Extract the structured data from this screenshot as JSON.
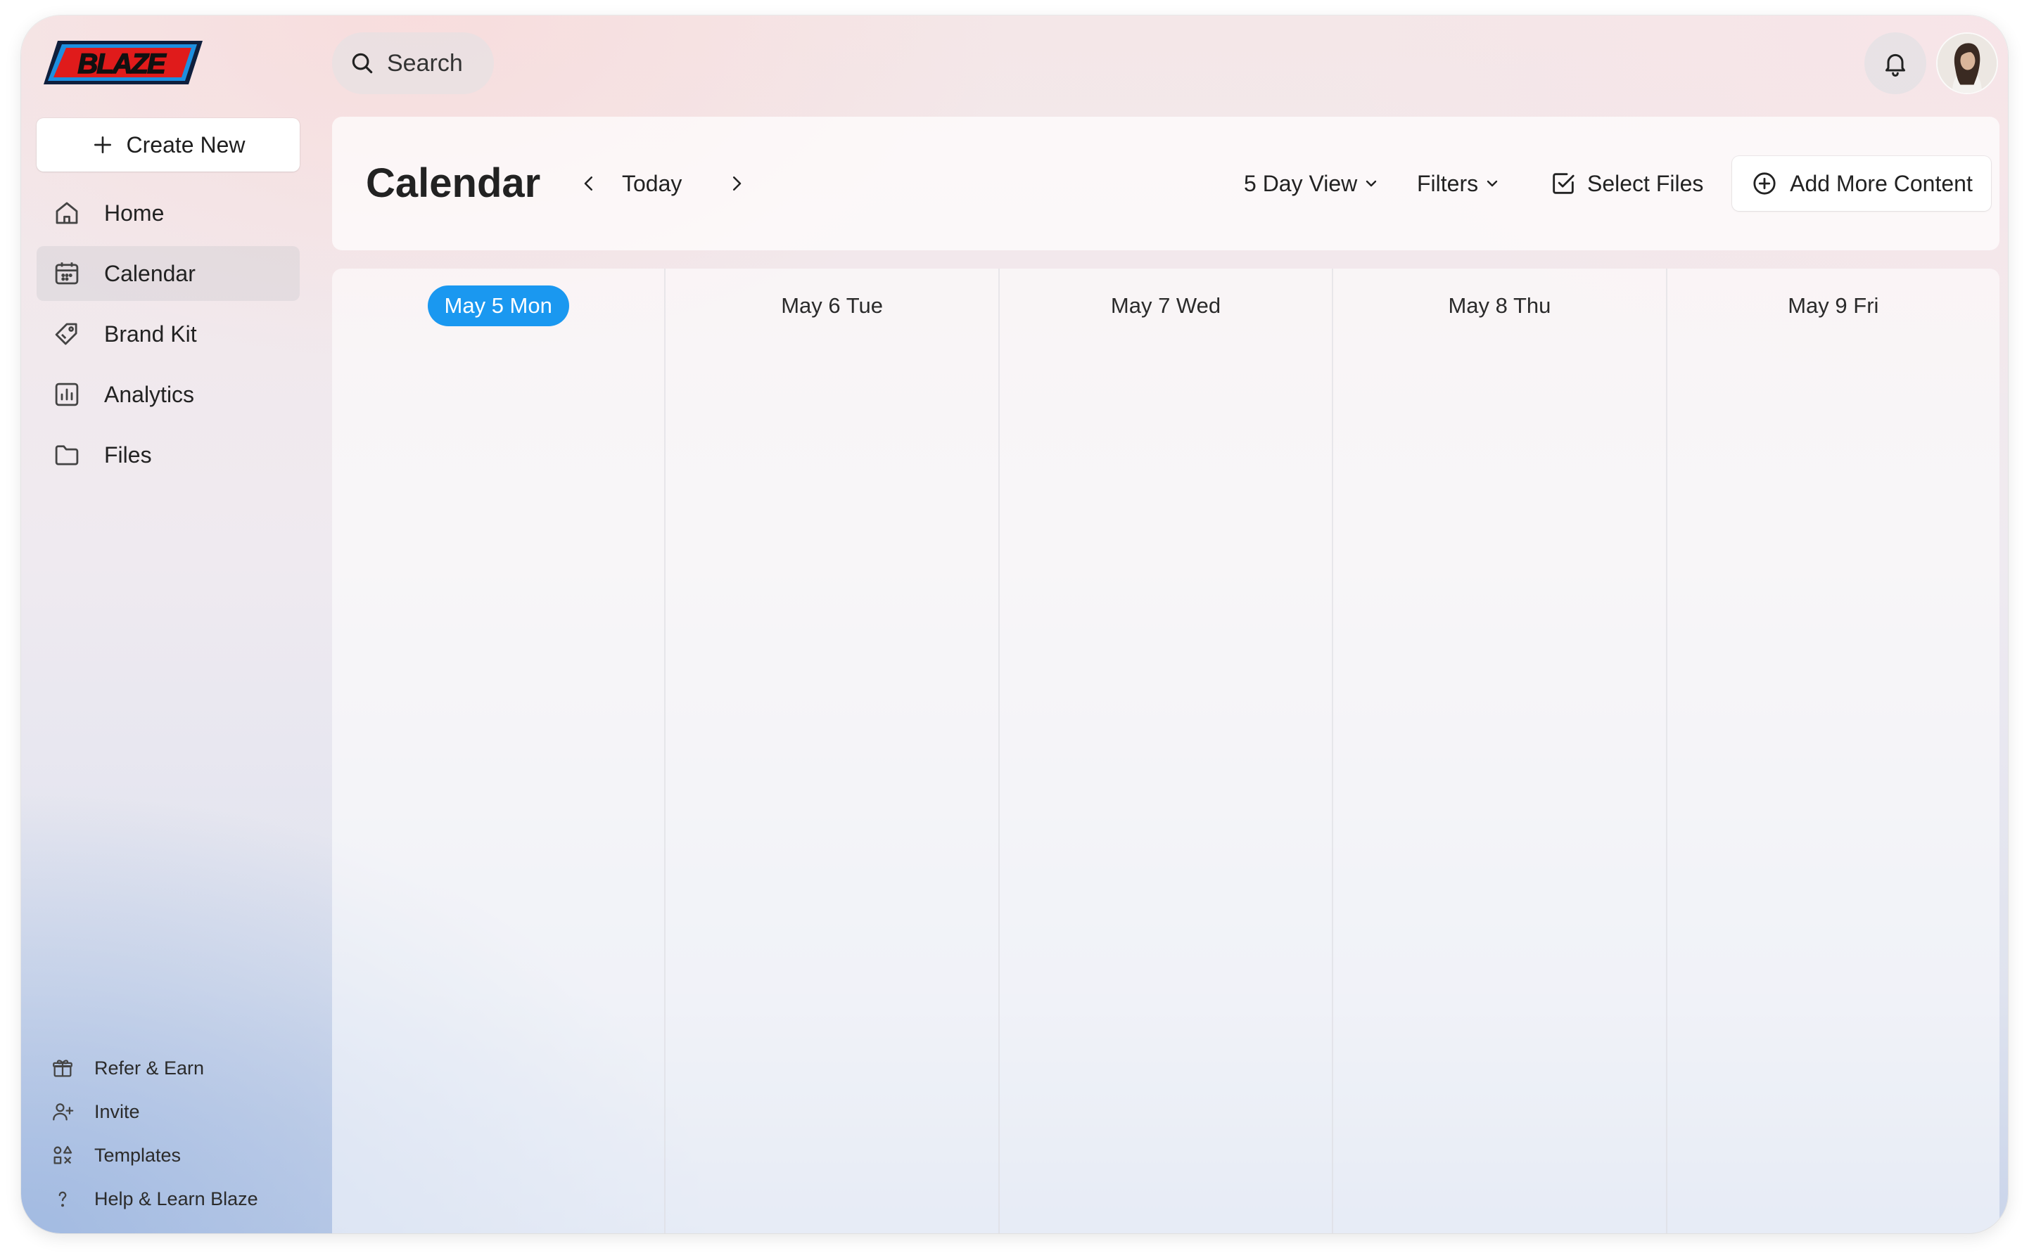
{
  "app": {
    "logo_text": "BLAZE"
  },
  "search": {
    "label": "Search"
  },
  "sidebar": {
    "create_label": "Create New",
    "items": [
      {
        "label": "Home",
        "icon": "home-icon",
        "active": false
      },
      {
        "label": "Calendar",
        "icon": "calendar-icon",
        "active": true
      },
      {
        "label": "Brand Kit",
        "icon": "tag-icon",
        "active": false
      },
      {
        "label": "Analytics",
        "icon": "analytics-icon",
        "active": false
      },
      {
        "label": "Files",
        "icon": "folder-icon",
        "active": false
      }
    ],
    "bottom_items": [
      {
        "label": "Refer & Earn",
        "icon": "gift-icon"
      },
      {
        "label": "Invite",
        "icon": "user-plus-icon"
      },
      {
        "label": "Templates",
        "icon": "templates-icon"
      },
      {
        "label": "Help & Learn Blaze",
        "icon": "help-icon"
      }
    ]
  },
  "calendar": {
    "title": "Calendar",
    "today_label": "Today",
    "view_label": "5 Day View",
    "filters_label": "Filters",
    "select_files_label": "Select Files",
    "add_content_label": "Add More Content",
    "today_color": "#1a98f0",
    "days": [
      {
        "label": "May 5 Mon",
        "is_today": true
      },
      {
        "label": "May 6 Tue",
        "is_today": false
      },
      {
        "label": "May 7 Wed",
        "is_today": false
      },
      {
        "label": "May 8 Thu",
        "is_today": false
      },
      {
        "label": "May 9 Fri",
        "is_today": false
      }
    ]
  }
}
